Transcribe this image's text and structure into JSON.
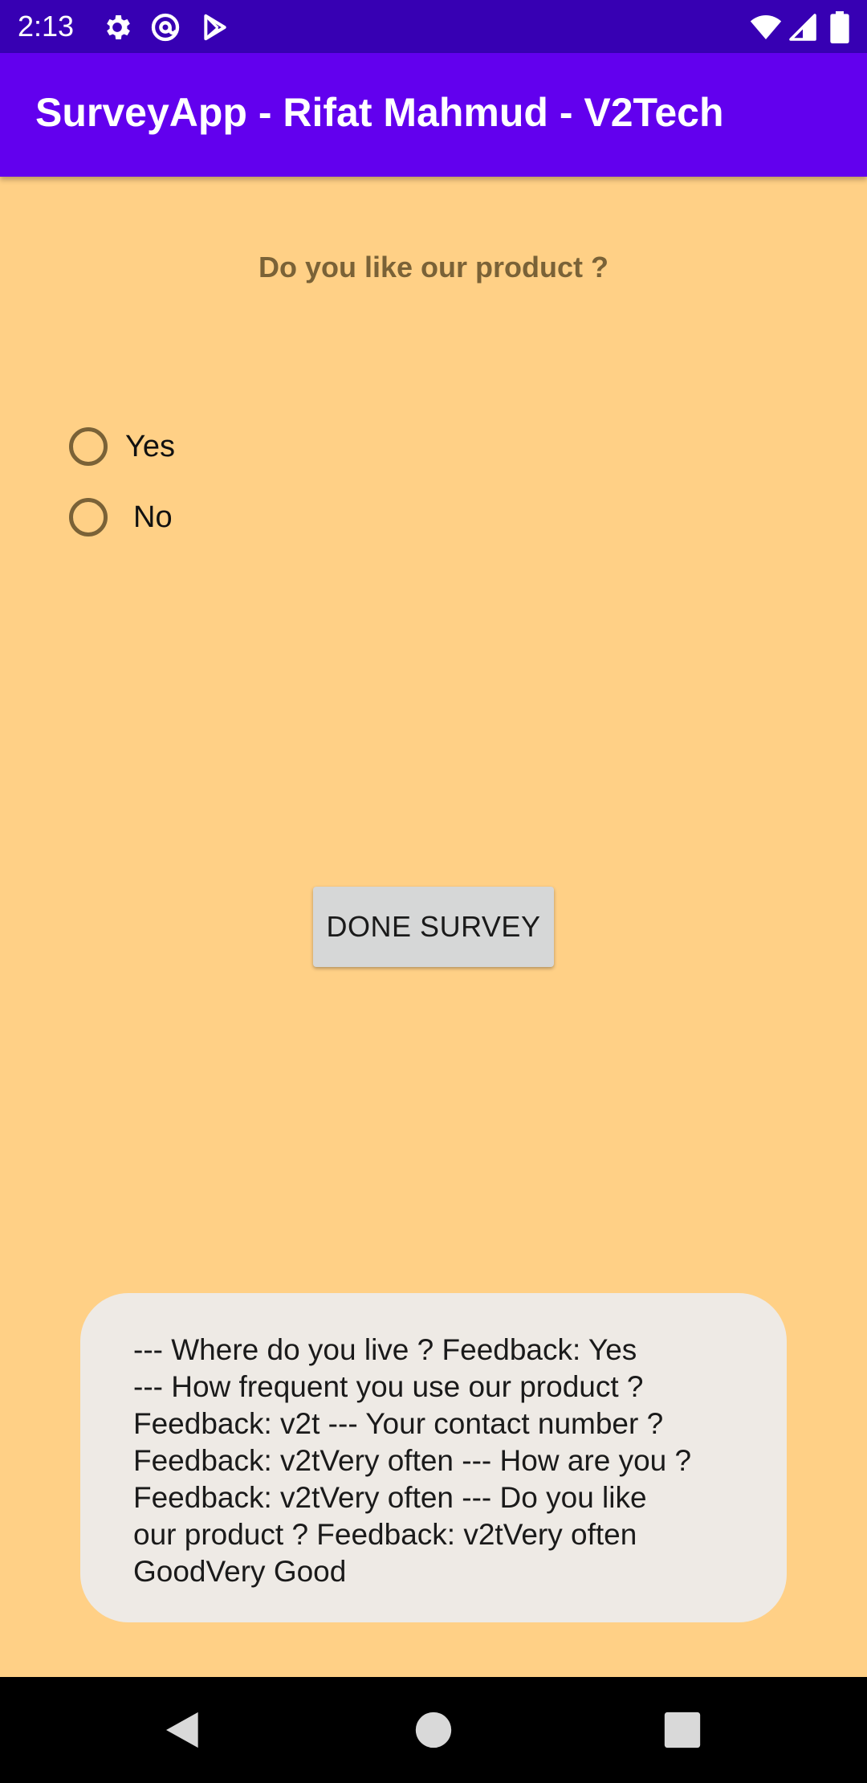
{
  "status_bar": {
    "time": "2:13",
    "icons_left": [
      "gear-icon",
      "at-sign-icon",
      "play-store-icon"
    ],
    "icons_right": [
      "wifi-icon",
      "signal-icon",
      "battery-icon"
    ]
  },
  "app_bar": {
    "title": "SurveyApp - Rifat Mahmud - V2Tech"
  },
  "survey": {
    "question": "Do you like our product ?",
    "options": [
      {
        "label": "Yes",
        "selected": false
      },
      {
        "label": "No",
        "selected": false
      }
    ],
    "done_button_label": "DONE SURVEY"
  },
  "toast": {
    "message": " --- Where do you live ? Feedback: Yes\n--- How frequent you use our product ?\nFeedback: v2t --- Your contact number ?\nFeedback: v2tVery often --- How are you ?\nFeedback: v2tVery often --- Do you like\nour product ? Feedback: v2tVery often\nGoodVery Good"
  },
  "nav_bar": {
    "buttons": [
      "back-icon",
      "home-icon",
      "recents-icon"
    ]
  },
  "colors": {
    "status_bar": "#3700B3",
    "app_bar": "#6200EE",
    "background": "#FFD086",
    "question_text": "#7A6237",
    "toast_bg": "#EEEAE5",
    "button_bg": "#D6D7D7"
  }
}
